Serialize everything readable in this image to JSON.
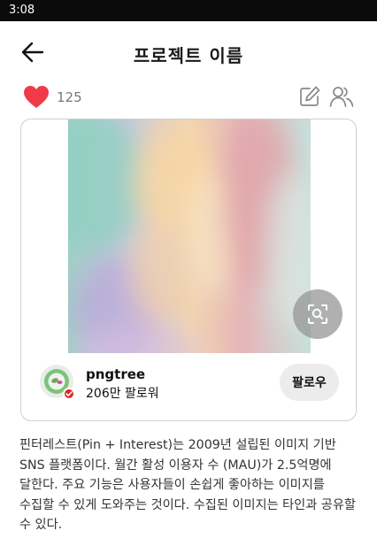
{
  "status_bar": {
    "time": "3:08"
  },
  "header": {
    "title": "프로젝트 이름",
    "back_icon": "arrow-left-icon"
  },
  "meta": {
    "likes": "125",
    "heart_color": "#f03a47",
    "edit_icon": "edit-icon",
    "collaborators_icon": "people-icon"
  },
  "pin": {
    "image_description_icon": "visual-search-icon",
    "author": {
      "name": "pngtree",
      "followers": "206만 팔로워",
      "verified_badge_color": "#e02424"
    },
    "follow_label": "팔로우"
  },
  "description": "핀터레스트(Pin + Interest)는 2009년 설립된 이미지 기반 SNS 플랫폼이다. 월간 활성 이용자 수 (MAU)가 2.5억명에 달한다. 주요 기능은 사용자들이 손쉽게 좋아하는 이미지를 수집할 수 있게 도와주는 것이다. 수집된 이미지는 타인과 공유할 수 있다."
}
